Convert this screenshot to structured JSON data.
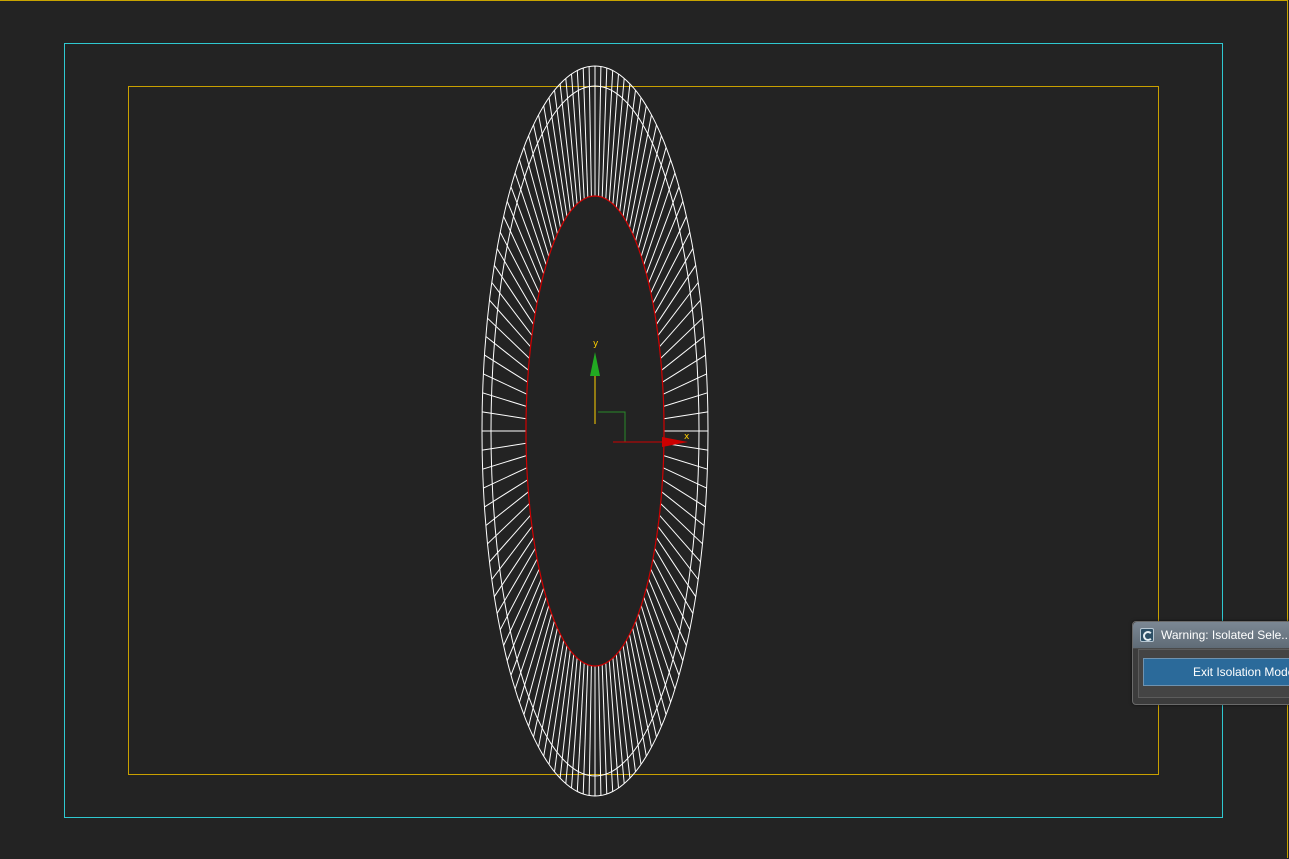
{
  "viewport": {
    "colors": {
      "background": "#232323",
      "outer_frame": "#2fc8d0",
      "inner_frame": "#c8a000",
      "wireframe": "#ffffff",
      "selection_edge": "#d00000",
      "gizmo_y": "#22aa22",
      "gizmo_x": "#cc0000",
      "gizmo_label": "#ffd000"
    },
    "gizmo": {
      "y_label": "y",
      "x_label": "x"
    }
  },
  "dialog": {
    "icon": "app-logo-icon",
    "title": "Warning: Isolated Sele...",
    "exit_button_label": "Exit Isolation Mode"
  }
}
